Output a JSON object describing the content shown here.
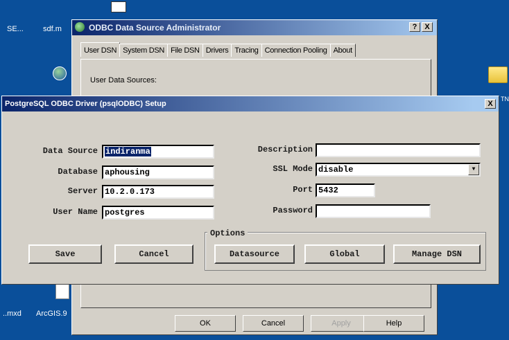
{
  "desktop": {
    "icons": [
      {
        "label": "SE..."
      },
      {
        "label": "sdf.m"
      },
      {
        "label": "..mxd"
      },
      {
        "label": "ArcGIS.9"
      },
      {
        "label": "TN"
      }
    ]
  },
  "odbc_admin": {
    "title": "ODBC Data Source Administrator",
    "help_btn": "?",
    "close_btn": "X",
    "tabs": [
      "User DSN",
      "System DSN",
      "File DSN",
      "Drivers",
      "Tracing",
      "Connection Pooling",
      "About"
    ],
    "user_data_sources_label": "User Data Sources:",
    "footer_text": "...",
    "buttons": {
      "ok": "OK",
      "cancel": "Cancel",
      "apply": "Apply",
      "help": "Help"
    }
  },
  "pg_setup": {
    "title": "PostgreSQL ODBC Driver (psqlODBC) Setup",
    "close_btn": "X",
    "fields": {
      "data_source": {
        "label": "Data Source",
        "value": "indiranma"
      },
      "database": {
        "label": "Database",
        "value": "aphousing"
      },
      "server": {
        "label": "Server",
        "value": "10.2.0.173"
      },
      "user_name": {
        "label": "User Name",
        "value": "postgres"
      },
      "description": {
        "label": "Description",
        "value": ""
      },
      "ssl_mode": {
        "label": "SSL Mode",
        "value": "disable"
      },
      "port": {
        "label": "Port",
        "value": "5432"
      },
      "password": {
        "label": "Password",
        "value": ""
      }
    },
    "buttons": {
      "save": "Save",
      "cancel": "Cancel"
    },
    "options": {
      "label": "Options",
      "datasource": "Datasource",
      "global": "Global",
      "manage_dsn": "Manage DSN"
    }
  },
  "colors": {
    "desktop": "#0a4f9a",
    "titlebar_start": "#0a246a",
    "titlebar_end": "#a6caf0",
    "face": "#d4d0c8"
  }
}
